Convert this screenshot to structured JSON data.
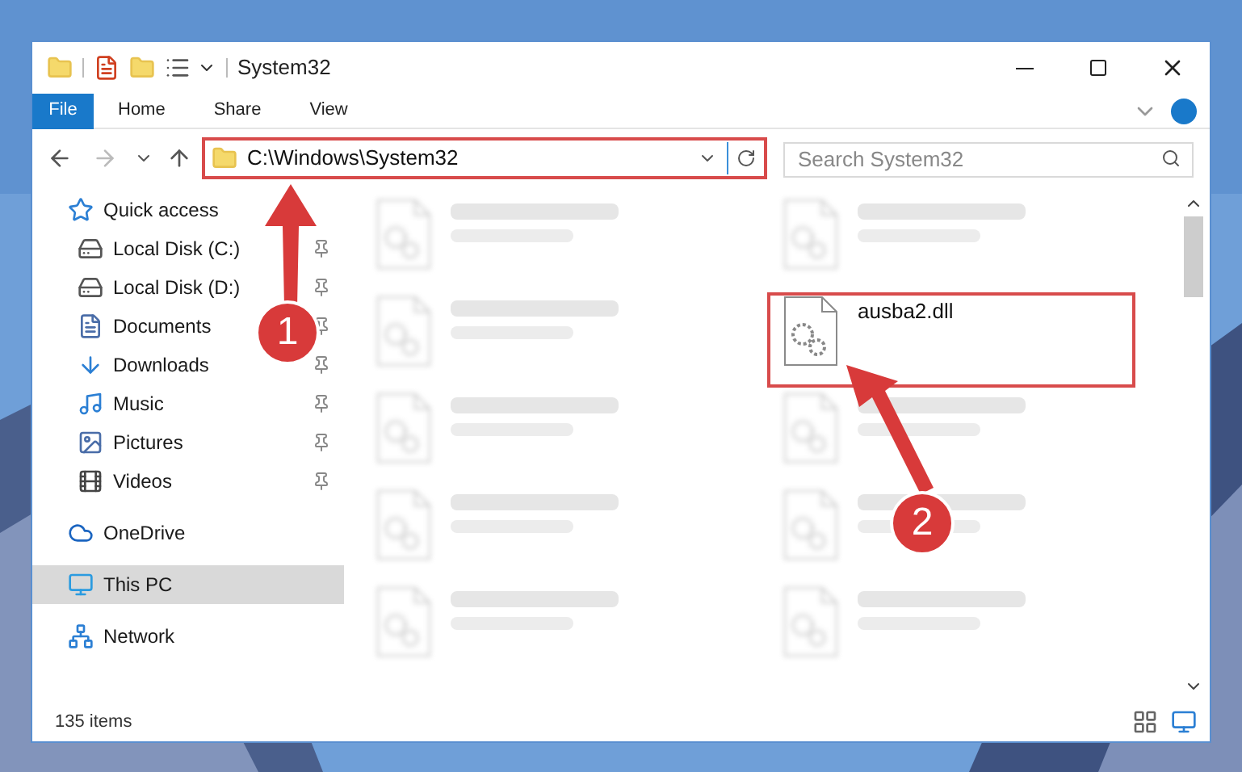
{
  "window": {
    "title": "System32"
  },
  "ribbon_tabs": [
    {
      "label": "File",
      "selected": true
    },
    {
      "label": "Home",
      "selected": false
    },
    {
      "label": "Share",
      "selected": false
    },
    {
      "label": "View",
      "selected": false
    }
  ],
  "address": {
    "value": "C:\\Windows\\System32"
  },
  "search": {
    "placeholder": "Search System32"
  },
  "sidebar": {
    "items": [
      {
        "label": "Quick access",
        "kind": "star",
        "selected": false,
        "children": [
          {
            "label": "Local Disk (C:)",
            "kind": "drive",
            "pinned": true,
            "selected": false
          },
          {
            "label": "Local Disk (D:)",
            "kind": "drive",
            "pinned": true,
            "selected": false
          },
          {
            "label": "Documents",
            "kind": "document",
            "pinned": true,
            "selected": false
          },
          {
            "label": "Downloads",
            "kind": "download",
            "pinned": true,
            "selected": false
          },
          {
            "label": "Music",
            "kind": "music",
            "pinned": true,
            "selected": false
          },
          {
            "label": "Pictures",
            "kind": "pictures",
            "pinned": true,
            "selected": false
          },
          {
            "label": "Videos",
            "kind": "videos",
            "pinned": true,
            "selected": false
          }
        ]
      },
      {
        "label": "OneDrive",
        "kind": "cloud",
        "selected": false
      },
      {
        "label": "This PC",
        "kind": "pc",
        "selected": true
      },
      {
        "label": "Network",
        "kind": "network",
        "selected": false
      }
    ]
  },
  "files": [
    {
      "kind": "blurred"
    },
    {
      "kind": "blurred"
    },
    {
      "kind": "blurred"
    },
    {
      "name": "ausba2.dll",
      "kind": "highlighted"
    },
    {
      "kind": "blurred"
    },
    {
      "kind": "blurred"
    },
    {
      "kind": "blurred"
    },
    {
      "kind": "blurred"
    },
    {
      "kind": "blurred"
    },
    {
      "kind": "blurred"
    }
  ],
  "status_bar": {
    "item_count": "135 items"
  },
  "annotations": [
    {
      "label": "1"
    },
    {
      "label": "2"
    }
  ]
}
